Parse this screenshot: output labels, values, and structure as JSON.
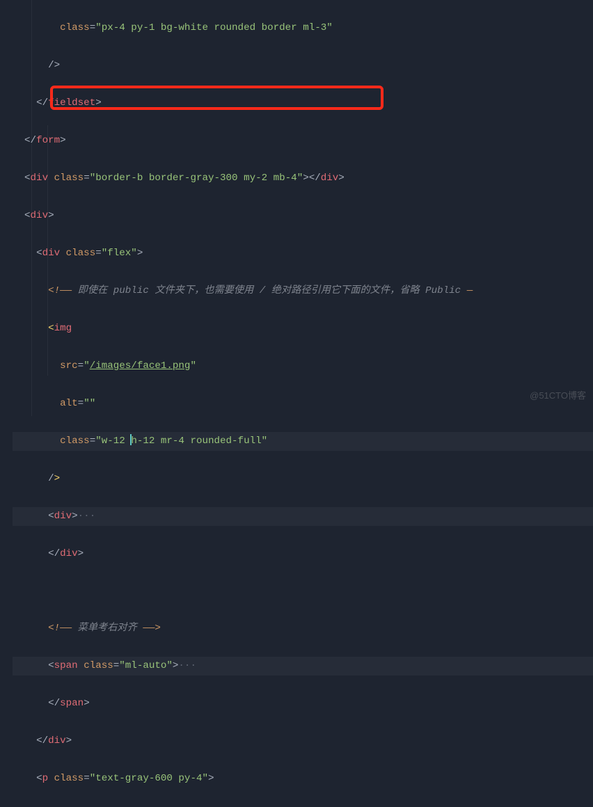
{
  "lines": {
    "l1_attr": "class",
    "l1_val": "\"px-4 py-1 bg-white rounded border ml-3\"",
    "l2_close": "/>",
    "l3_tag": "fieldset",
    "l4_tag": "form",
    "l5_tag_open": "div",
    "l5_attr": "class",
    "l5_val": "\"border-b border-gray-300 my-2 mb-4\"",
    "l5_tag_close": "div",
    "l6_tag": "div",
    "l7_tag": "div",
    "l7_attr": "class",
    "l7_val": "\"flex\"",
    "l8_comment": " 即使在 public 文件夹下，也需要使用 / 绝对路径引用它下面的文件，省略 Public ",
    "l9_tag": "img",
    "l10_attr": "src",
    "l10_val_pre": "\"",
    "l10_val_u": "/images/face1.png",
    "l10_val_post": "\"",
    "l11_attr": "alt",
    "l11_val": "\"\"",
    "l12_attr": "class",
    "l12_val_a": "\"w-12 ",
    "l12_val_b": "h-12 mr-4 rounded-full\"",
    "l13_close": "/",
    "l14_tag": "div",
    "l15_tag": "div",
    "l17_comment": " 菜单考右对齐 ",
    "l18_tag": "span",
    "l18_attr": "class",
    "l18_val": "\"ml-auto\"",
    "l19_tag": "span",
    "l20_tag": "div",
    "l21_tag": "p",
    "l21_attr": "class",
    "l21_val": "\"text-gray-600 py-4\"",
    "fold": "···",
    "watermark": "@51CTO博客"
  }
}
